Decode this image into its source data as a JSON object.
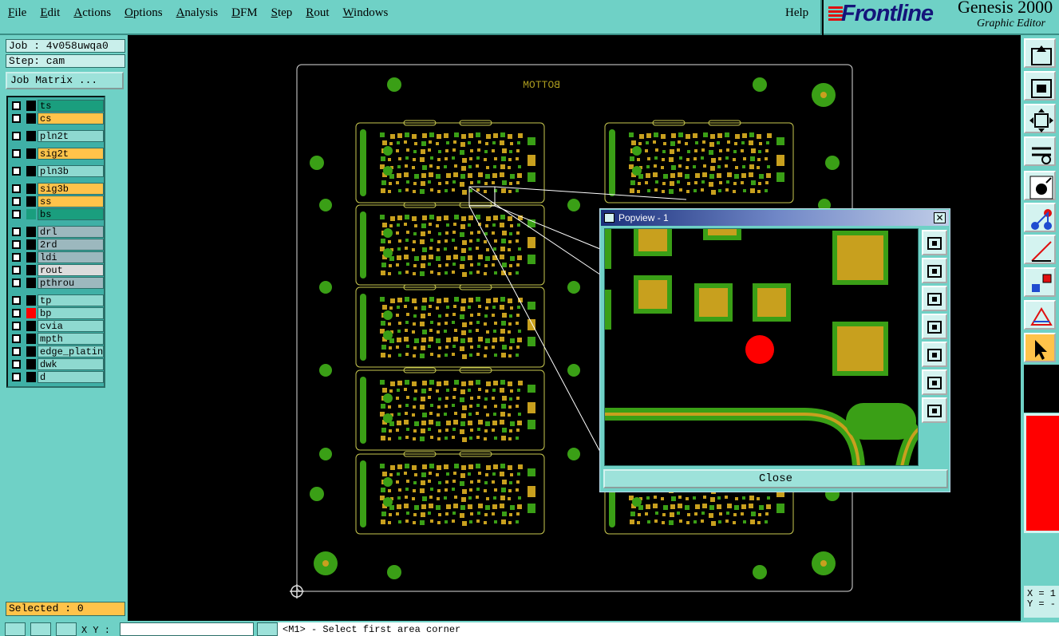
{
  "menu": {
    "items": [
      "File",
      "Edit",
      "Actions",
      "Options",
      "Analysis",
      "DFM",
      "Step",
      "Rout",
      "Windows"
    ],
    "help": "Help"
  },
  "brand": {
    "logo": "Frontline",
    "product": "Genesis 2000",
    "subtitle": "Graphic Editor"
  },
  "job": {
    "job_label": "Job : 4v058uwqa0",
    "step_label": "Step: cam",
    "matrix_button": "Job Matrix ..."
  },
  "layers": [
    {
      "name": "ts",
      "color": "#1a9e7e",
      "swatch": "#000000",
      "group": 0
    },
    {
      "name": "cs",
      "color": "#ffc34a",
      "swatch": "#000000",
      "group": 0
    },
    {
      "name": "pln2t",
      "color": "#8ed9d0",
      "swatch": "#000000",
      "group": 1
    },
    {
      "name": "sig2t",
      "color": "#ffc34a",
      "swatch": "#000000",
      "group": 2
    },
    {
      "name": "pln3b",
      "color": "#8ed9d0",
      "swatch": "#000000",
      "group": 3
    },
    {
      "name": "sig3b",
      "color": "#ffc34a",
      "swatch": "#000000",
      "group": 4
    },
    {
      "name": "ss",
      "color": "#ffc34a",
      "swatch": "#000000",
      "group": 4
    },
    {
      "name": "bs",
      "color": "#1a9e7e",
      "swatch": "#1a9e7e",
      "group": 4
    },
    {
      "name": "drl",
      "color": "#9cb8be",
      "swatch": "#000000",
      "group": 5
    },
    {
      "name": "2rd",
      "color": "#9cb8be",
      "swatch": "#000000",
      "group": 5
    },
    {
      "name": "ldi",
      "color": "#9cb8be",
      "swatch": "#000000",
      "group": 5
    },
    {
      "name": "rout",
      "color": "#dcdcdc",
      "swatch": "#000000",
      "group": 5
    },
    {
      "name": "pthrou",
      "color": "#9cb8be",
      "swatch": "#000000",
      "group": 5
    },
    {
      "name": "tp",
      "color": "#8ed9d0",
      "swatch": "#000000",
      "group": 6
    },
    {
      "name": "bp",
      "color": "#8ed9d0",
      "swatch": "#ff0000",
      "group": 6
    },
    {
      "name": "cvia",
      "color": "#8ed9d0",
      "swatch": "#000000",
      "group": 6
    },
    {
      "name": "mpth",
      "color": "#8ed9d0",
      "swatch": "#000000",
      "group": 6
    },
    {
      "name": "edge_plating",
      "color": "#8ed9d0",
      "swatch": "#000000",
      "group": 6
    },
    {
      "name": "dwk",
      "color": "#8ed9d0",
      "swatch": "#000000",
      "group": 6
    },
    {
      "name": "d",
      "color": "#8ed9d0",
      "swatch": "#000000",
      "group": 6
    }
  ],
  "selected": "Selected : 0",
  "status": {
    "xy_label": "X Y :",
    "xy_value": "",
    "message": "<M1> - Select first area corner"
  },
  "board": {
    "label": "BOTTOM"
  },
  "coords": {
    "x_label": "X = 1",
    "y_label": "Y = -"
  },
  "popview": {
    "title": "Popview - 1",
    "close_x": "✕",
    "close_button": "Close"
  },
  "colors": {
    "panel": "#6fd1c6",
    "pad_green": "#3a9f16",
    "pad_gold": "#c8a01e",
    "flash_red": "#ff0000",
    "board_outline": "#c8c850"
  }
}
